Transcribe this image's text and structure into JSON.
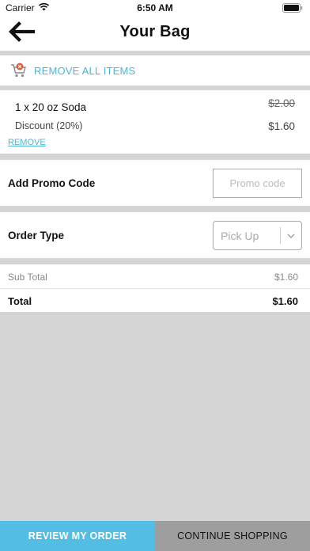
{
  "status_bar": {
    "carrier": "Carrier",
    "time": "6:50 AM"
  },
  "header": {
    "title": "Your Bag",
    "back_icon": "back-arrow-icon"
  },
  "bag": {
    "remove_all_label": "REMOVE ALL ITEMS",
    "remove_all_icon": "cart-remove-icon",
    "items": [
      {
        "name": "1 x 20 oz Soda",
        "original_price": "$2.00",
        "discount_label": "Discount (20%)",
        "discounted_price": "$1.60",
        "remove_label": "REMOVE"
      }
    ]
  },
  "promo": {
    "label": "Add Promo Code",
    "placeholder": "Promo code",
    "value": ""
  },
  "order_type": {
    "label": "Order Type",
    "selected": "Pick Up"
  },
  "totals": {
    "subtotal_label": "Sub Total",
    "subtotal_value": "$1.60",
    "total_label": "Total",
    "total_value": "$1.60"
  },
  "actions": {
    "review_label": "REVIEW MY ORDER",
    "continue_label": "CONTINUE SHOPPING"
  },
  "colors": {
    "accent": "#54bde4",
    "link": "#4db6d9",
    "secondary_button": "#9e9e9e",
    "background": "#d5d5d5",
    "remove_badge": "#e0573c"
  }
}
